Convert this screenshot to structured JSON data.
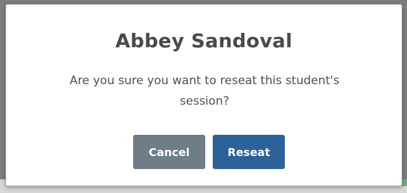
{
  "dialog": {
    "title": "Abbey Sandoval",
    "message": "Are you sure you want to reseat this student's session?",
    "cancel_label": "Cancel",
    "confirm_label": "Reseat"
  },
  "colors": {
    "title_text": "#4a4a4a",
    "cancel_button": "#6f7d86",
    "confirm_button": "#2d6199",
    "overlay": "#7d7d7d"
  }
}
